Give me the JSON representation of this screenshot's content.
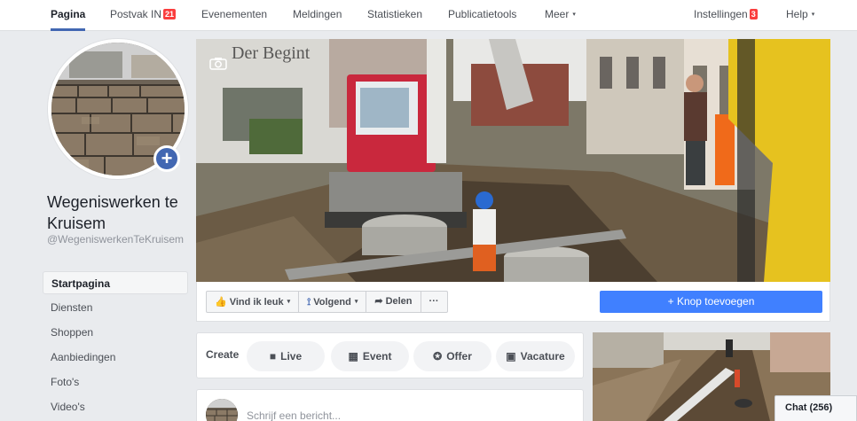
{
  "topnav": {
    "items": [
      {
        "label": "Pagina",
        "badge": ""
      },
      {
        "label": "Postvak IN",
        "badge": "21"
      },
      {
        "label": "Evenementen",
        "badge": ""
      },
      {
        "label": "Meldingen",
        "badge": ""
      },
      {
        "label": "Statistieken",
        "badge": ""
      },
      {
        "label": "Publicatietools",
        "badge": ""
      },
      {
        "label": "Meer",
        "badge": ""
      }
    ],
    "settings_label": "Instellingen",
    "settings_badge": "3",
    "help_label": "Help",
    "caret": "▾"
  },
  "page": {
    "name": "Wegeniswerken te Kruisem",
    "handle": "@WegeniswerkenTeKruisem",
    "add_photo_symbol": "+"
  },
  "sidebar": {
    "items": [
      {
        "label": "Startpagina"
      },
      {
        "label": "Diensten"
      },
      {
        "label": "Shoppen"
      },
      {
        "label": "Aanbiedingen"
      },
      {
        "label": "Foto's"
      },
      {
        "label": "Video's"
      }
    ]
  },
  "actions": {
    "like_label": "Vind ik leuk",
    "follow_label": "Volgend",
    "share_label": "Delen",
    "more_label": "···",
    "add_button_label": "+ Knop toevoegen"
  },
  "create": {
    "label": "Create",
    "buttons": [
      {
        "label": "Live",
        "icon": "live-video-icon"
      },
      {
        "label": "Event",
        "icon": "calendar-icon"
      },
      {
        "label": "Offer",
        "icon": "offer-tag-icon"
      },
      {
        "label": "Vacature",
        "icon": "briefcase-icon"
      }
    ]
  },
  "composer": {
    "placeholder": "Schrijf een bericht..."
  },
  "cover": {
    "sign_text": "Der Begint"
  },
  "chat": {
    "label": "Chat (256)"
  },
  "colors": {
    "accent": "#4267b2",
    "button_blue": "#4080ff",
    "badge_red": "#fa3e3e",
    "background": "#e9ebee"
  }
}
